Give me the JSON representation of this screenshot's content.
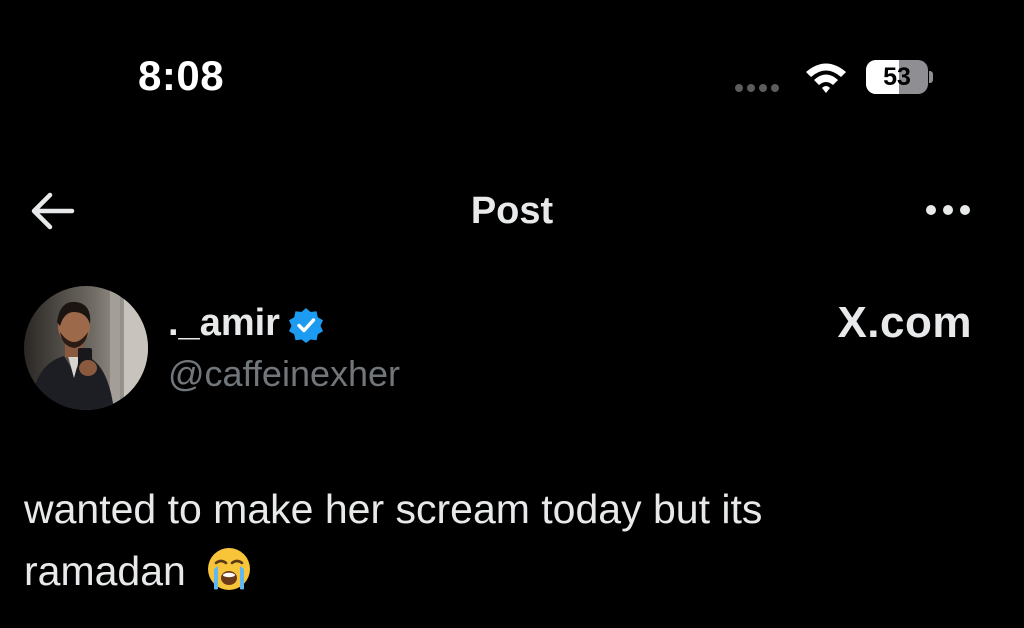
{
  "status_bar": {
    "time": "8:08",
    "battery_percent": "53",
    "battery_level": 0.53,
    "icons": [
      "signal-dots-icon",
      "wifi-icon",
      "battery-icon"
    ]
  },
  "nav": {
    "title": "Post",
    "back_icon": "back-arrow-icon",
    "more_icon": "more-icon"
  },
  "author": {
    "display_name": "._amir",
    "handle": "@caffeinexher",
    "verified_icon": "verified-badge-icon",
    "verified_color": "#1d9bf0"
  },
  "watermark": "X.com",
  "post": {
    "text": "wanted to make her scream today but its ramadan",
    "emoji": "loudly-crying-face-emoji"
  },
  "colors": {
    "background": "#000000",
    "primary_text": "#e7e9ea",
    "secondary_text": "#71767b"
  }
}
